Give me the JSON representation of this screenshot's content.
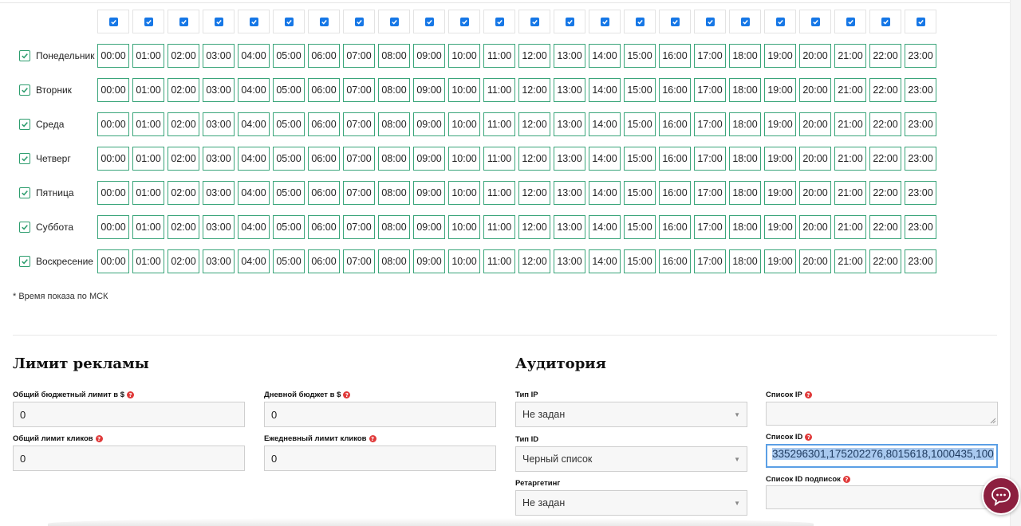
{
  "schedule": {
    "hours": [
      "00:00",
      "01:00",
      "02:00",
      "03:00",
      "04:00",
      "05:00",
      "06:00",
      "07:00",
      "08:00",
      "09:00",
      "10:00",
      "11:00",
      "12:00",
      "13:00",
      "14:00",
      "15:00",
      "16:00",
      "17:00",
      "18:00",
      "19:00",
      "20:00",
      "21:00",
      "22:00",
      "23:00"
    ],
    "days": [
      "Понедельник",
      "Вторник",
      "Среда",
      "Четверг",
      "Пятница",
      "Суббота",
      "Воскресение"
    ],
    "all_hours_checked": true,
    "all_days_checked": true,
    "note": "* Время показа по МСК"
  },
  "limits": {
    "title": "Лимит рекламы",
    "total_budget_label": "Общий бюджетный лимит в $",
    "total_budget_value": "0",
    "daily_budget_label": "Дневной бюджет в $",
    "daily_budget_value": "0",
    "total_clicks_label": "Общий лимит кликов",
    "total_clicks_value": "0",
    "daily_clicks_label": "Ежедневный лимит кликов",
    "daily_clicks_value": "0"
  },
  "audience": {
    "title": "Аудитория",
    "ip_type_label": "Тип IP",
    "ip_type_value": "Не задан",
    "id_type_label": "Тип ID",
    "id_type_value": "Черный список",
    "retargeting_label": "Ретаргетинг",
    "retargeting_value": "Не задан",
    "ip_list_label": "Список IP",
    "id_list_label": "Список ID",
    "id_list_value": "335296301,175202276,8015618,1000435,100",
    "subscriptions_list_label": "Список ID подписок"
  },
  "colors": {
    "accent_green": "#2d9d6e",
    "checkbox_blue": "#1677e6",
    "help_red": "#e03a3a",
    "chat_bg": "#8c1f3f"
  },
  "icons": {
    "help": "question-circle-icon",
    "chat": "chat-bubble-icon",
    "dropdown": "caret-down-icon"
  }
}
